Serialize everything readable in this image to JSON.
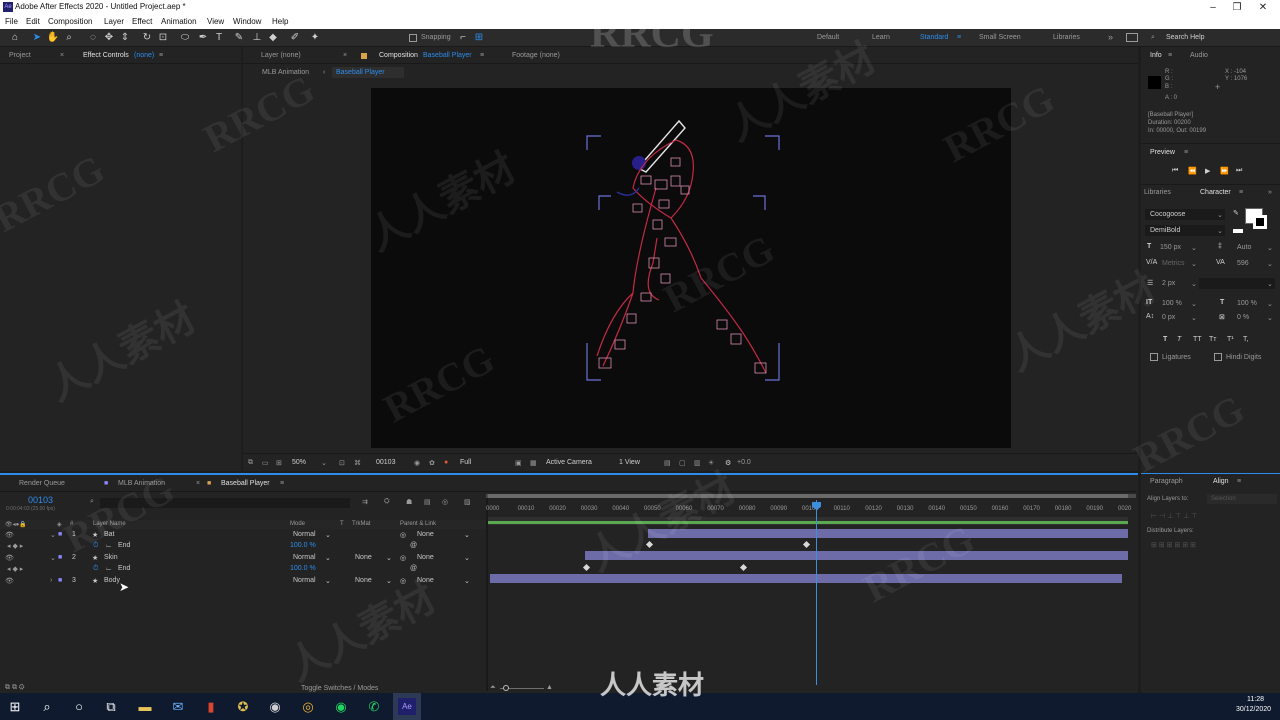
{
  "title_bar": {
    "app_icon": "Ae",
    "title": "Adobe After Effects 2020 - Untitled Project.aep *"
  },
  "menu": [
    "File",
    "Edit",
    "Composition",
    "Layer",
    "Effect",
    "Animation",
    "View",
    "Window",
    "Help"
  ],
  "toolbar": {
    "snapping": "Snapping",
    "workspaces": [
      "Default",
      "Learn",
      "Standard",
      "Small Screen",
      "Libraries"
    ],
    "active_workspace": "Standard",
    "search": "Search Help"
  },
  "project_panel": {
    "tab_project": "Project",
    "tab_effect_controls": "Effect Controls",
    "effect_target": "(none)"
  },
  "comp_panel": {
    "tab_layer": "Layer (none)",
    "tab_composition": "Composition",
    "comp_name": "Baseball Player",
    "tab_footage": "Footage (none)",
    "breadcrumb_parent": "MLB Animation",
    "breadcrumb_current": "Baseball Player",
    "zoom": "50%",
    "timecode": "00103",
    "resolution": "Full",
    "camera": "Active Camera",
    "views": "1 View",
    "exposure": "+0.0"
  },
  "timeline": {
    "tabs": [
      "Render Queue",
      "MLB Animation",
      "Baseball Player"
    ],
    "active_tab": "Baseball Player",
    "current_frame": "00103",
    "current_time_sub": "0:00:04:03 (25.00 fps)",
    "columns": {
      "layer_name": "Layer Name",
      "mode": "Mode",
      "t": "T",
      "trkmat": "TrkMat",
      "parent": "Parent & Link"
    },
    "layers": [
      {
        "num": "1",
        "name": "Bat",
        "mode": "Normal",
        "trkmat": "",
        "parent": "None",
        "prop": "End",
        "prop_value": "100.0 %"
      },
      {
        "num": "2",
        "name": "Skin",
        "mode": "Normal",
        "trkmat": "None",
        "parent": "None",
        "prop": "End",
        "prop_value": "100.0 %"
      },
      {
        "num": "3",
        "name": "Body",
        "mode": "Normal",
        "trkmat": "None",
        "parent": "None"
      }
    ],
    "ruler": [
      "0000",
      "00010",
      "00020",
      "00030",
      "00040",
      "00050",
      "00060",
      "00070",
      "00080",
      "00090",
      "00100",
      "00110",
      "00120",
      "00130",
      "00140",
      "00150",
      "00160",
      "00170",
      "00180",
      "00190",
      "0020"
    ],
    "playhead_frame": 103,
    "toggle_label": "Toggle Switches / Modes"
  },
  "info_panel": {
    "tabs": [
      "Info",
      "Audio"
    ],
    "r": "R :",
    "g": "G :",
    "b": "B :",
    "a": "A : 0",
    "x": "X : -104",
    "y": "Y : 1076",
    "comp_name": "[Baseball Player]",
    "duration": "Duration: 00200",
    "in_out": "In: 00000, Out: 00199"
  },
  "preview_panel": {
    "title": "Preview"
  },
  "character_panel": {
    "tabs": [
      "Libraries",
      "Character"
    ],
    "font": "Cocogoose",
    "style": "DemiBold",
    "size": "150 px",
    "leading": "Auto",
    "kerning": "Metrics",
    "tracking": "596",
    "stroke": "2 px",
    "vscale": "100 %",
    "hscale": "100 %",
    "baseline": "0 px",
    "tsume": "0 %",
    "styles": [
      "T",
      "T",
      "TT",
      "Tт",
      "T¹",
      "T,"
    ],
    "ligatures": "Ligatures",
    "hindi": "Hindi Digits"
  },
  "align_panel": {
    "tabs": [
      "Paragraph",
      "Align"
    ],
    "align_to_label": "Align Layers to:",
    "align_to_value": "Selection",
    "distribute": "Distribute Layers:"
  },
  "taskbar": {
    "time": "11:28",
    "date": "30/12/2020"
  },
  "watermark": {
    "text_a": "RRCG",
    "text_b": "人人素材"
  },
  "colors": {
    "accent": "#2d8ceb",
    "label_purple": "#8c86ff",
    "layer_bar": "#6e6ca8",
    "playhead": "#3b8fdc"
  }
}
